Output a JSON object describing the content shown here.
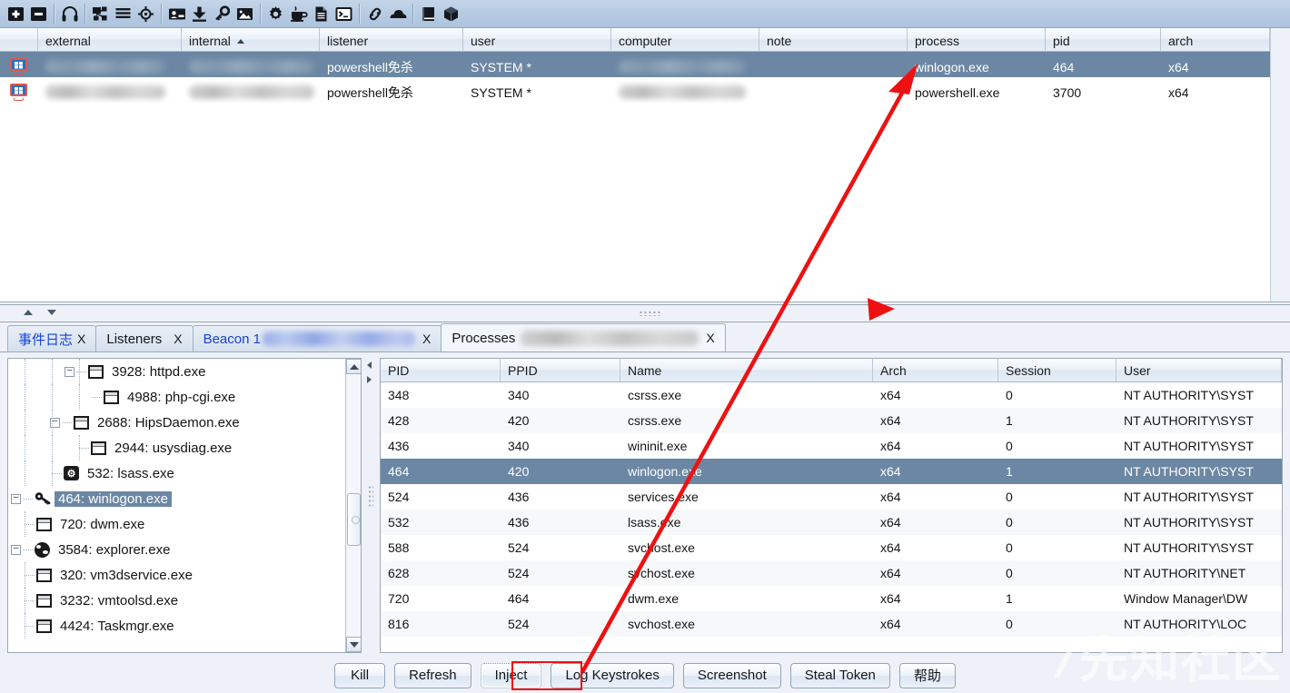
{
  "toolbar": {
    "groups": [
      {
        "items": [
          {
            "name": "add-icon",
            "glyph": "plus-square"
          },
          {
            "name": "remove-icon",
            "glyph": "minus-square"
          }
        ]
      },
      {
        "items": [
          {
            "name": "headphones-icon",
            "glyph": "headphones"
          }
        ]
      },
      {
        "items": [
          {
            "name": "pivot-graph-icon",
            "glyph": "pivot"
          },
          {
            "name": "session-list-icon",
            "glyph": "lines"
          },
          {
            "name": "targets-icon",
            "glyph": "crosshair"
          }
        ]
      },
      {
        "items": [
          {
            "name": "credentials-icon",
            "glyph": "card"
          },
          {
            "name": "downloads-icon",
            "glyph": "download"
          },
          {
            "name": "keystrokes-icon",
            "glyph": "key"
          },
          {
            "name": "screenshots-icon",
            "glyph": "image"
          }
        ]
      },
      {
        "items": [
          {
            "name": "settings-icon",
            "glyph": "gear"
          },
          {
            "name": "java-applet-icon",
            "glyph": "coffee"
          },
          {
            "name": "script-icon",
            "glyph": "document"
          },
          {
            "name": "console-icon",
            "glyph": "terminal"
          }
        ]
      },
      {
        "items": [
          {
            "name": "link-icon",
            "glyph": "link"
          },
          {
            "name": "cloud-icon",
            "glyph": "cloud"
          }
        ]
      },
      {
        "items": [
          {
            "name": "book-icon",
            "glyph": "book"
          },
          {
            "name": "package-icon",
            "glyph": "cube"
          }
        ]
      }
    ]
  },
  "beacon_table": {
    "columns": [
      "external",
      "internal",
      "listener",
      "user",
      "computer",
      "note",
      "process",
      "pid",
      "arch"
    ],
    "sorted_column": "internal",
    "sort_direction": "asc",
    "rows": [
      {
        "selected": true,
        "external": "",
        "internal": "",
        "listener": "powershell免杀",
        "user": "SYSTEM *",
        "computer": "",
        "note": "",
        "process": "winlogon.exe",
        "pid": "464",
        "arch": "x64",
        "redacted": [
          "external",
          "internal",
          "computer"
        ]
      },
      {
        "selected": false,
        "external": "",
        "internal": "",
        "listener": "powershell免杀",
        "user": "SYSTEM *",
        "computer": "",
        "note": "",
        "process": "powershell.exe",
        "pid": "3700",
        "arch": "x64",
        "redacted": [
          "external",
          "internal",
          "computer"
        ]
      }
    ]
  },
  "tabs": [
    {
      "label": "事件日志",
      "close": "X",
      "active": false,
      "blue": true,
      "redacted": false
    },
    {
      "label": "Listeners",
      "close": "X",
      "active": false,
      "blue": false,
      "redacted": false
    },
    {
      "label": "Beacon 1",
      "close": "X",
      "active": false,
      "blue": true,
      "redacted": true
    },
    {
      "label": "Processes",
      "close": "X",
      "active": true,
      "blue": false,
      "redacted": true
    }
  ],
  "process_tree": {
    "nodes": [
      {
        "depth": 3,
        "expander": "minus",
        "icon": "window-icon",
        "label": "3928: httpd.exe",
        "selected": false
      },
      {
        "depth": 4,
        "expander": "none",
        "icon": "window-icon",
        "label": "4988: php-cgi.exe",
        "selected": false
      },
      {
        "depth": 2,
        "expander": "minus",
        "icon": "window-icon",
        "label": "2688: HipsDaemon.exe",
        "selected": false
      },
      {
        "depth": 3,
        "expander": "none",
        "icon": "window-icon",
        "label": "2944: usysdiag.exe",
        "selected": false
      },
      {
        "depth": 2,
        "expander": "none",
        "icon": "gear-icon",
        "label": "532: lsass.exe",
        "selected": false
      },
      {
        "depth": 0,
        "expander": "minus",
        "icon": "key-icon",
        "label": "464: winlogon.exe",
        "selected": true
      },
      {
        "depth": 1,
        "expander": "none",
        "icon": "window-icon",
        "label": "720: dwm.exe",
        "selected": false
      },
      {
        "depth": 0,
        "expander": "minus",
        "icon": "globe-icon",
        "label": "3584: explorer.exe",
        "selected": false
      },
      {
        "depth": 1,
        "expander": "none",
        "icon": "window-icon",
        "label": "320: vm3dservice.exe",
        "selected": false
      },
      {
        "depth": 1,
        "expander": "none",
        "icon": "window-icon",
        "label": "3232: vmtoolsd.exe",
        "selected": false
      },
      {
        "depth": 1,
        "expander": "none",
        "icon": "window-icon",
        "label": "4424: Taskmgr.exe",
        "selected": false
      }
    ]
  },
  "process_table": {
    "columns": [
      "PID",
      "PPID",
      "Name",
      "Arch",
      "Session",
      "User"
    ],
    "rows": [
      {
        "pid": "348",
        "ppid": "340",
        "name": "csrss.exe",
        "arch": "x64",
        "session": "0",
        "user": "NT AUTHORITY\\SYST",
        "selected": false
      },
      {
        "pid": "428",
        "ppid": "420",
        "name": "csrss.exe",
        "arch": "x64",
        "session": "1",
        "user": "NT AUTHORITY\\SYST",
        "selected": false
      },
      {
        "pid": "436",
        "ppid": "340",
        "name": "wininit.exe",
        "arch": "x64",
        "session": "0",
        "user": "NT AUTHORITY\\SYST",
        "selected": false
      },
      {
        "pid": "464",
        "ppid": "420",
        "name": "winlogon.exe",
        "arch": "x64",
        "session": "1",
        "user": "NT AUTHORITY\\SYST",
        "selected": true
      },
      {
        "pid": "524",
        "ppid": "436",
        "name": "services.exe",
        "arch": "x64",
        "session": "0",
        "user": "NT AUTHORITY\\SYST",
        "selected": false
      },
      {
        "pid": "532",
        "ppid": "436",
        "name": "lsass.exe",
        "arch": "x64",
        "session": "0",
        "user": "NT AUTHORITY\\SYST",
        "selected": false
      },
      {
        "pid": "588",
        "ppid": "524",
        "name": "svchost.exe",
        "arch": "x64",
        "session": "0",
        "user": "NT AUTHORITY\\SYST",
        "selected": false
      },
      {
        "pid": "628",
        "ppid": "524",
        "name": "svchost.exe",
        "arch": "x64",
        "session": "0",
        "user": "NT AUTHORITY\\NET",
        "selected": false
      },
      {
        "pid": "720",
        "ppid": "464",
        "name": "dwm.exe",
        "arch": "x64",
        "session": "1",
        "user": "Window Manager\\DW",
        "selected": false
      },
      {
        "pid": "816",
        "ppid": "524",
        "name": "svchost.exe",
        "arch": "x64",
        "session": "0",
        "user": "NT AUTHORITY\\LOC",
        "selected": false
      }
    ]
  },
  "buttons": [
    {
      "label": "Kill",
      "name": "kill-button",
      "highlighted": false
    },
    {
      "label": "Refresh",
      "name": "refresh-button",
      "highlighted": false
    },
    {
      "label": "Inject",
      "name": "inject-button",
      "highlighted": true
    },
    {
      "label": "Log Keystrokes",
      "name": "log-keystrokes-button",
      "highlighted": false
    },
    {
      "label": "Screenshot",
      "name": "screenshot-button",
      "highlighted": false
    },
    {
      "label": "Steal Token",
      "name": "steal-token-button",
      "highlighted": false
    },
    {
      "label": "帮助",
      "name": "help-button",
      "highlighted": false
    }
  ],
  "watermark": {
    "text": "先知社区"
  },
  "colors": {
    "selection": "#6b87a3",
    "annotation": "#ee1111",
    "header_bg": "#e6eef7",
    "toolbar_bg": "#b6cbe2"
  }
}
